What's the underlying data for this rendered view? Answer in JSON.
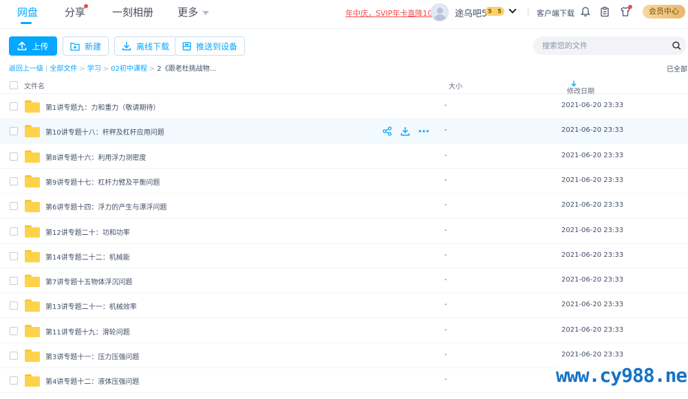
{
  "nav": {
    "tabs": [
      {
        "label": "网盘"
      },
      {
        "label": "分享"
      },
      {
        "label": "一刻相册"
      },
      {
        "label": "更多"
      }
    ],
    "promo": "年中庆，SVIP年卡直降100",
    "username": "途乌吧5",
    "vip_level": [
      "5",
      "5"
    ],
    "client_download": "客户端下载",
    "vip_center": "会员中心"
  },
  "toolbar": {
    "upload": "上传",
    "new": "新建",
    "offline_download": "离线下载",
    "push_device": "推送到设备"
  },
  "search": {
    "placeholder": "搜索您的文件"
  },
  "breadcrumb": {
    "back": "返回上一级",
    "items": [
      "全部文件",
      "学习",
      "02初中课程"
    ],
    "current": "2《跟老杜挑战物..."
  },
  "loaded_all": "已全部",
  "table": {
    "headers": {
      "name": "文件名",
      "size": "大小",
      "modified": "修改日期"
    },
    "rows": [
      {
        "name": "第1讲专题九：力和重力（敬请期待）",
        "size": "-",
        "modified": "2021-06-20 23:33"
      },
      {
        "name": "第10讲专题十八：杆秤及杠杆应用问题",
        "size": "-",
        "modified": "2021-06-20 23:33"
      },
      {
        "name": "第8讲专题十六：利用浮力测密度",
        "size": "-",
        "modified": "2021-06-20 23:33"
      },
      {
        "name": "第9讲专题十七：杠杆力臂及平衡问题",
        "size": "-",
        "modified": "2021-06-20 23:33"
      },
      {
        "name": "第6讲专题十四：浮力的产生与漂浮问题",
        "size": "-",
        "modified": "2021-06-20 23:33"
      },
      {
        "name": "第12讲专题二十：功和功率",
        "size": "-",
        "modified": "2021-06-20 23:33"
      },
      {
        "name": "第14讲专题二十二：机械能",
        "size": "-",
        "modified": "2021-06-20 23:33"
      },
      {
        "name": "第7讲专题十五物体浮沉问题",
        "size": "-",
        "modified": "2021-06-20 23:33"
      },
      {
        "name": "第13讲专题二十一：机械效率",
        "size": "-",
        "modified": "2021-06-20 23:33"
      },
      {
        "name": "第11讲专题十九：滑轮问题",
        "size": "-",
        "modified": "2021-06-20 23:33"
      },
      {
        "name": "第3讲专题十一：压力压强问题",
        "size": "-",
        "modified": "2021-06-20 23:33"
      },
      {
        "name": "第4讲专题十二：液体压强问题",
        "size": "-",
        "modified": ""
      }
    ]
  },
  "watermark": "www.cy988.net",
  "colors": {
    "accent": "#06a7ff",
    "promo": "#f5474a",
    "folder": "#ffd24c"
  }
}
